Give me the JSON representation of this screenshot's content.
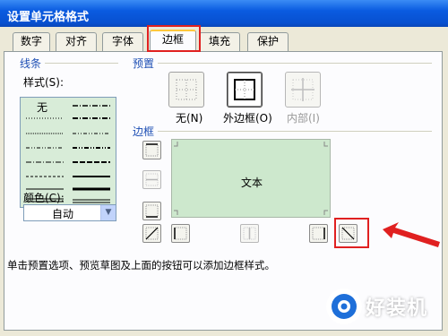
{
  "window": {
    "title": "设置单元格格式"
  },
  "tabs": [
    {
      "label": "数字"
    },
    {
      "label": "对齐"
    },
    {
      "label": "字体"
    },
    {
      "label": "边框"
    },
    {
      "label": "填充"
    },
    {
      "label": "保护"
    }
  ],
  "line_group": {
    "title": "线条",
    "style_label": "样式(S):",
    "style_none": "无",
    "color_label": "颜色(C):",
    "color_value": "自动"
  },
  "preset_group": {
    "title": "预置",
    "none_label": "无(N)",
    "outline_label": "外边框(O)",
    "inside_label": "内部(I)"
  },
  "border_group": {
    "title": "边框",
    "preview_text": "文本"
  },
  "note": "单击预置选项、预览草图及上面的按钮可以添加边框样式。",
  "watermark": {
    "brand": "好装机"
  },
  "colors": {
    "highlight": "#e02020",
    "preview_bg": "#cde8cd",
    "list_bg": "#d8ecd8",
    "title_blue": "#0a5be0"
  }
}
